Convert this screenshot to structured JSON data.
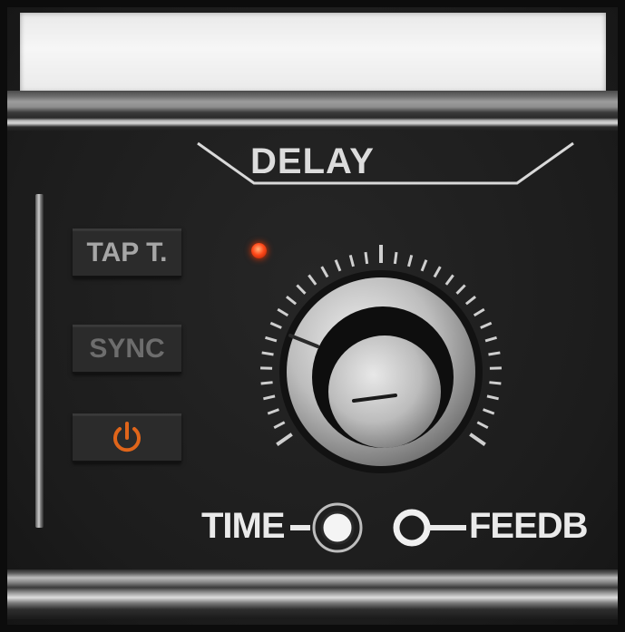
{
  "module": {
    "title": "DELAY"
  },
  "buttons": {
    "tap_tempo": "TAP T.",
    "sync": "SYNC",
    "power_icon": "power-icon"
  },
  "led": {
    "state": "on",
    "color": "#ff3a00"
  },
  "knob": {
    "assigned_parameter": "TIME"
  },
  "mode_switch": {
    "left_label": "TIME",
    "right_label": "FEEDB",
    "selected": "TIME"
  },
  "colors": {
    "panel": "#1e1e1e",
    "label": "#eaeaea",
    "power_accent": "#e0651a",
    "led": "#ff3a00"
  }
}
